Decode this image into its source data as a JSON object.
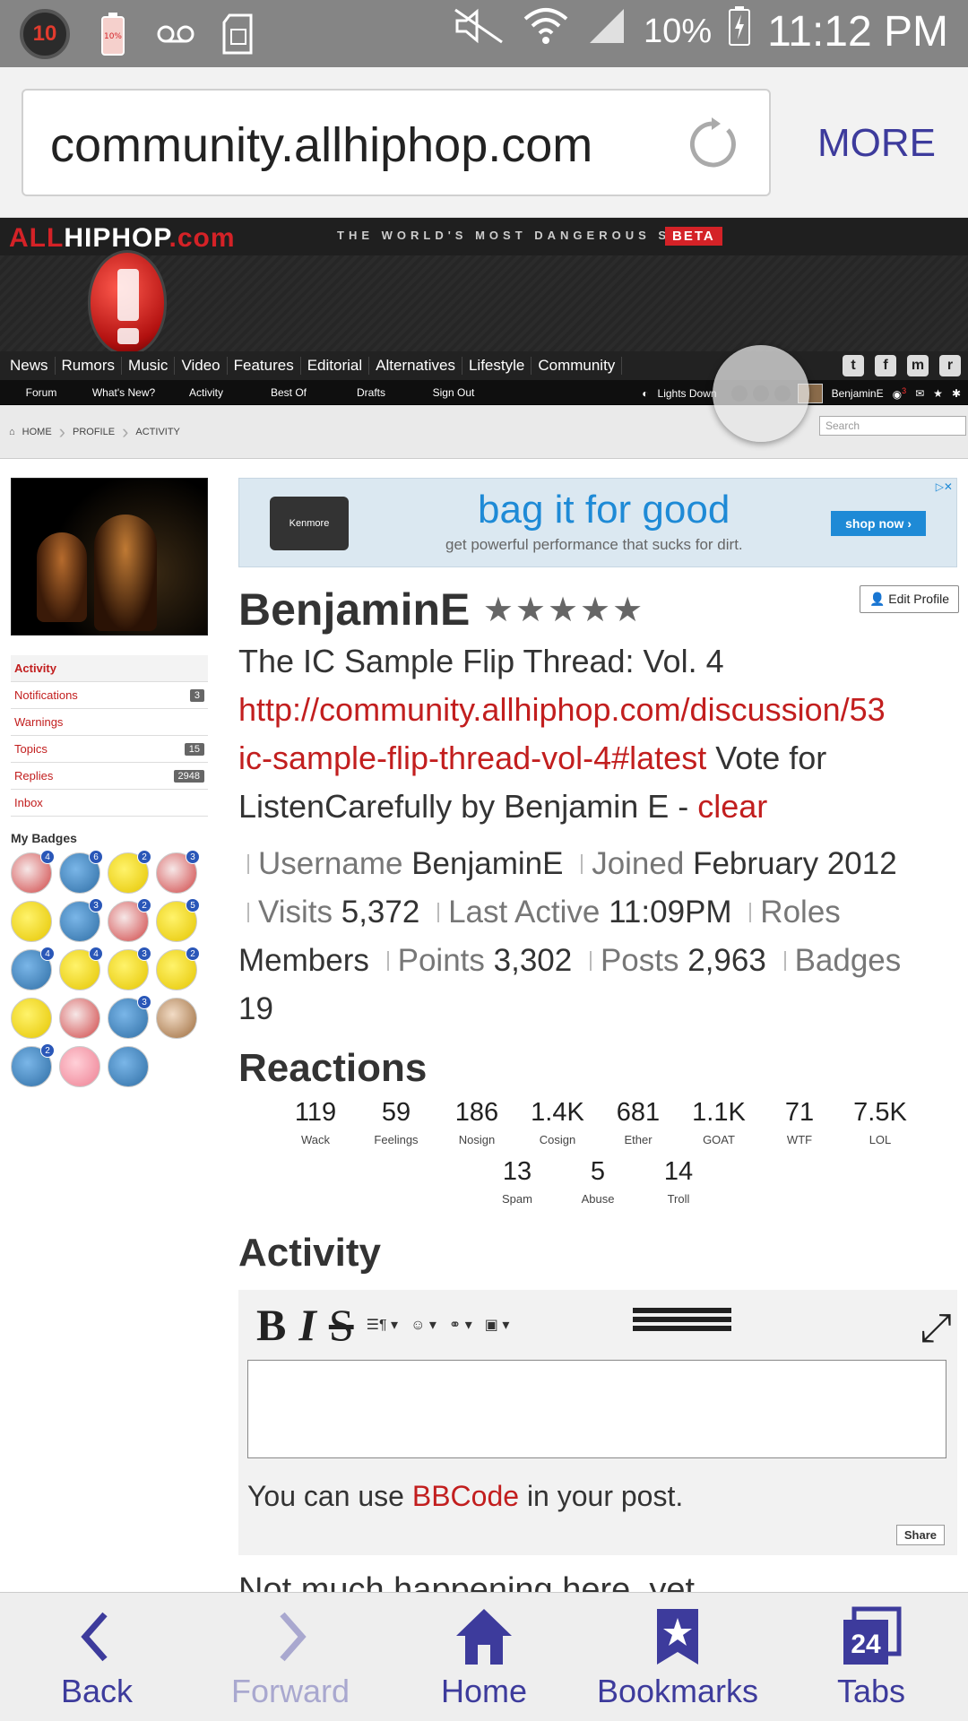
{
  "status_bar": {
    "notification_count": "10",
    "battery_icon_label": "10%",
    "battery_percent": "10%",
    "time": "11:12 PM"
  },
  "browser": {
    "url": "community.allhiphop.com",
    "more_label": "MORE",
    "bottom": {
      "back": "Back",
      "forward": "Forward",
      "home": "Home",
      "bookmarks": "Bookmarks",
      "tabs": "Tabs",
      "tab_count": "24"
    }
  },
  "site": {
    "logo_part1": "ALL",
    "logo_part2": "HIPHOP",
    "logo_part3": ".com",
    "tagline": "THE WORLD'S MOST DANGEROUS SITE",
    "beta": "BETA",
    "nav": [
      "News",
      "Rumors",
      "Music",
      "Video",
      "Features",
      "Editorial",
      "Alternatives",
      "Lifestyle",
      "Community"
    ],
    "subnav": [
      "Forum",
      "What's New?",
      "Activity",
      "Best Of",
      "Drafts",
      "Sign Out"
    ],
    "lights_down": "Lights Down",
    "current_user": "BenjaminE",
    "notif_badge": "3",
    "search_placeholder": "Search",
    "breadcrumbs": [
      "HOME",
      "PROFILE",
      "ACTIVITY"
    ]
  },
  "sidebar": {
    "menu": [
      {
        "label": "Activity",
        "count": ""
      },
      {
        "label": "Notifications",
        "count": "3"
      },
      {
        "label": "Warnings",
        "count": ""
      },
      {
        "label": "Topics",
        "count": "15"
      },
      {
        "label": "Replies",
        "count": "2948"
      },
      {
        "label": "Inbox",
        "count": ""
      }
    ],
    "badges_title": "My Badges"
  },
  "ad": {
    "brand": "Kenmore",
    "headline": "bag it for good",
    "subline": "get powerful performance that sucks for dirt.",
    "button": "shop now ›"
  },
  "profile": {
    "username": "BenjaminE",
    "stars": "★★★★★",
    "edit_profile": "Edit Profile",
    "status_line1": "The IC Sample Flip Thread: Vol. 4",
    "status_link1": "http://community.allhiphop.com/discussion/53",
    "status_link2": "ic-sample-flip-thread-vol-4#latest",
    "status_text2": " Vote for",
    "status_line4": "ListenCarefully by Benjamin E - ",
    "clear": "clear",
    "info": {
      "username_label": "Username",
      "username_value": "BenjaminE",
      "joined_label": "Joined",
      "joined_value": "February 2012",
      "visits_label": "Visits",
      "visits_value": "5,372",
      "last_active_label": "Last Active",
      "last_active_value": "11:09PM",
      "roles_label": "Roles",
      "roles_value": "Members",
      "points_label": "Points",
      "points_value": "3,302",
      "posts_label": "Posts",
      "posts_value": "2,963",
      "badges_label": "Badges",
      "badges_value": "19"
    }
  },
  "reactions": {
    "heading": "Reactions",
    "items": [
      {
        "count": "119",
        "label": "Wack"
      },
      {
        "count": "59",
        "label": "Feelings"
      },
      {
        "count": "186",
        "label": "Nosign"
      },
      {
        "count": "1.4K",
        "label": "Cosign"
      },
      {
        "count": "681",
        "label": "Ether"
      },
      {
        "count": "1.1K",
        "label": "GOAT"
      },
      {
        "count": "71",
        "label": "WTF"
      },
      {
        "count": "7.5K",
        "label": "LOL"
      },
      {
        "count": "13",
        "label": "Spam"
      },
      {
        "count": "5",
        "label": "Abuse"
      },
      {
        "count": "14",
        "label": "Troll"
      }
    ]
  },
  "activity": {
    "heading": "Activity",
    "toolbar_bold": "B",
    "toolbar_italic": "I",
    "toolbar_strike": "S",
    "bbcode_prefix": "You can use ",
    "bbcode_link": "BBCode",
    "bbcode_suffix": " in your post.",
    "share": "Share",
    "empty": "Not much happening here, yet."
  }
}
